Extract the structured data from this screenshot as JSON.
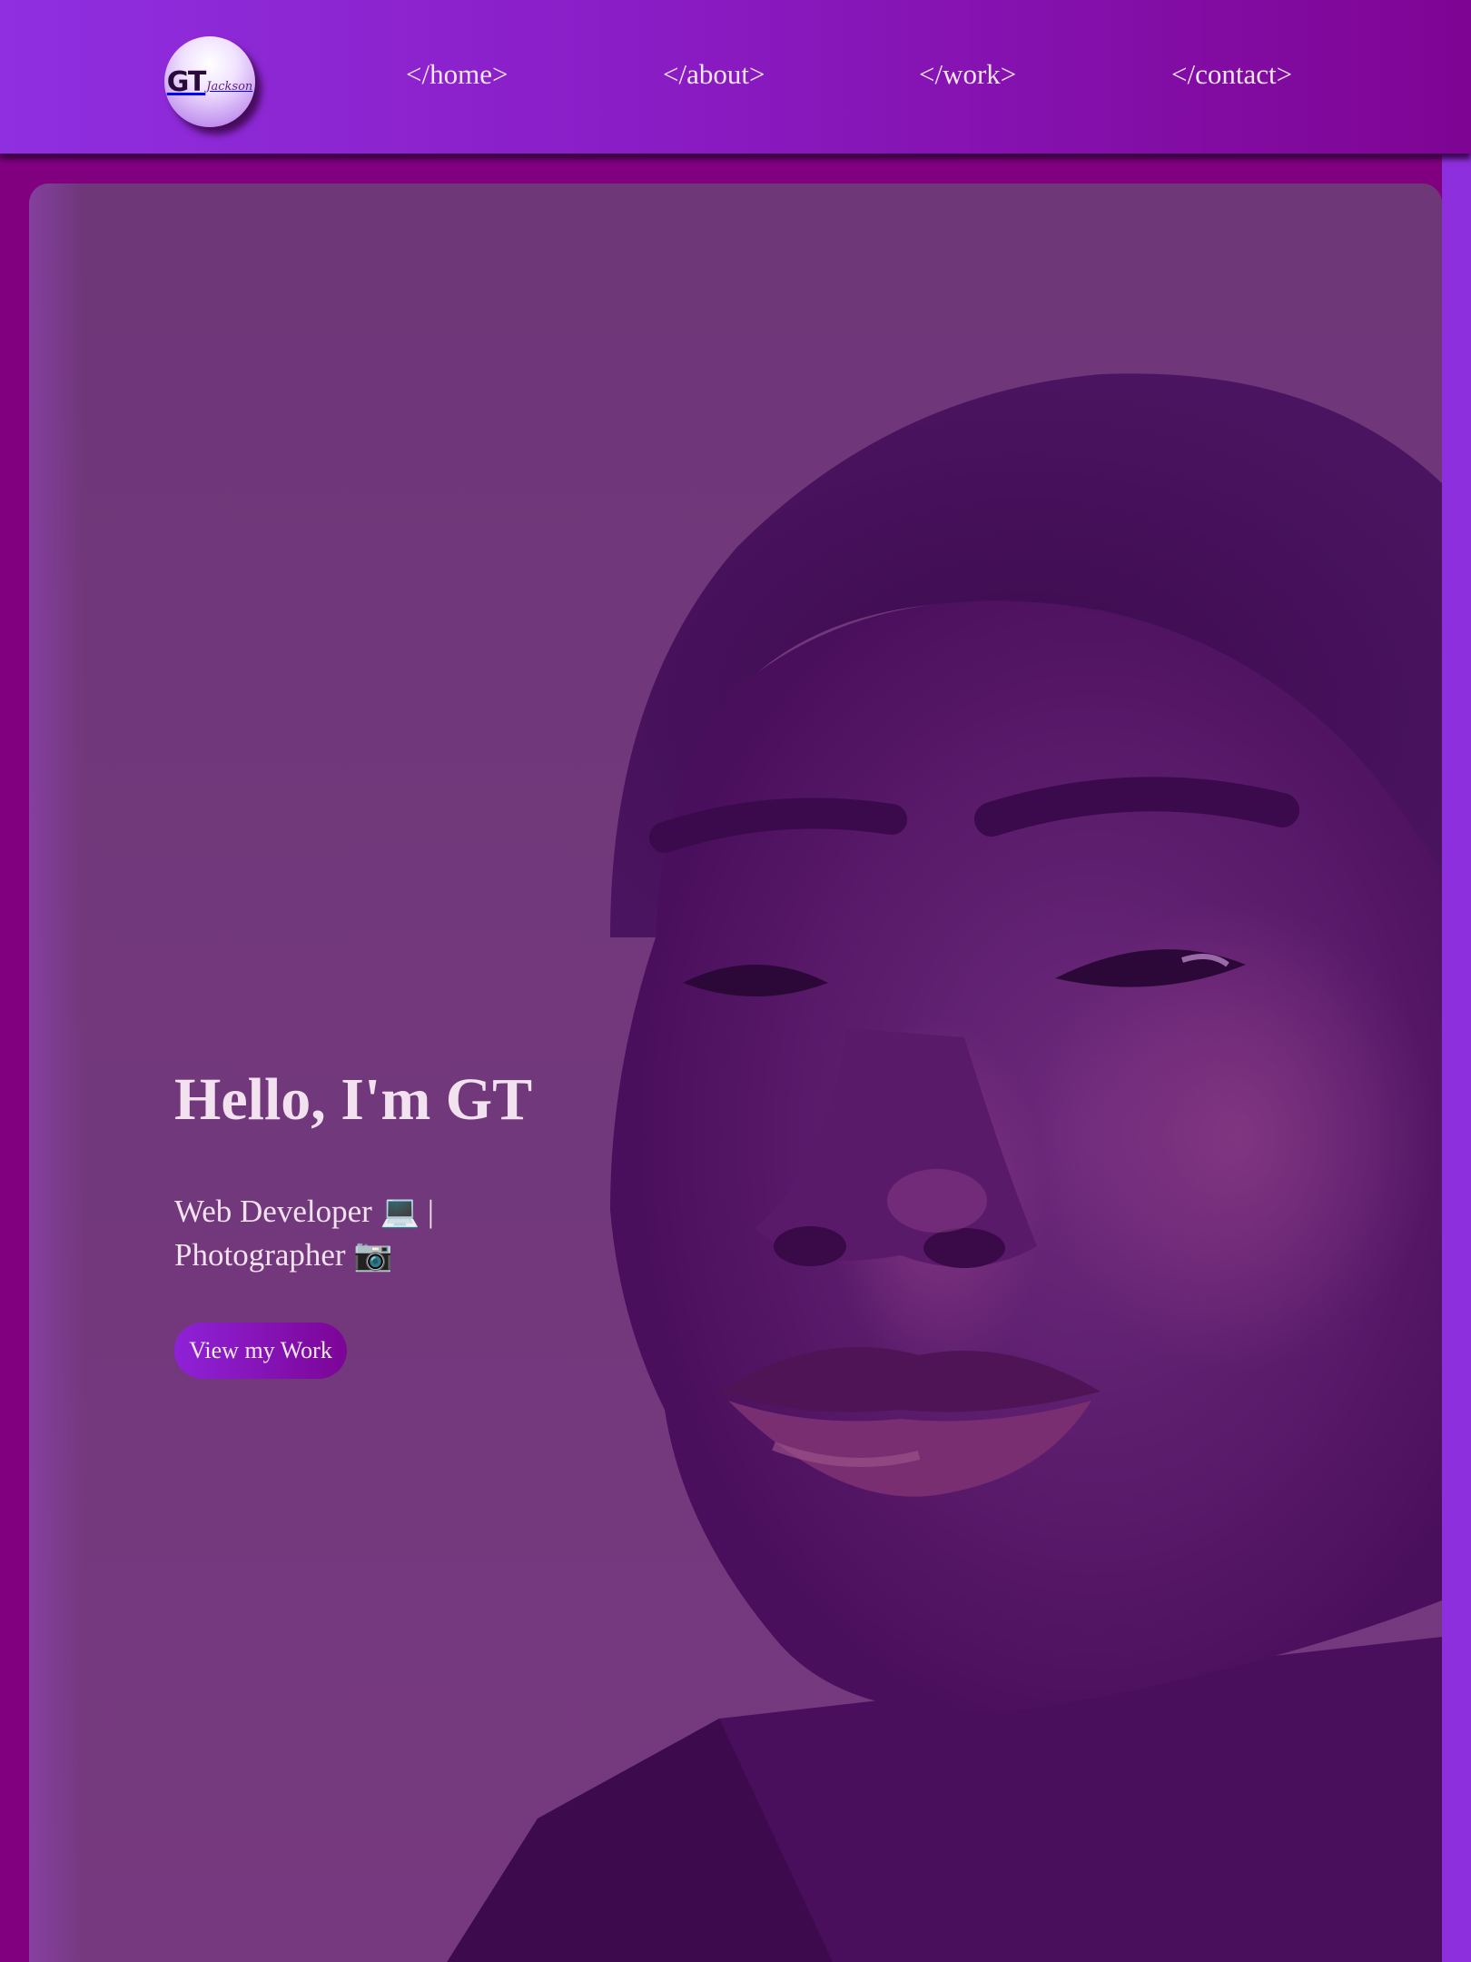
{
  "nav": {
    "logo": {
      "initials": "GT",
      "script": "Jackson"
    },
    "links": [
      "</home>",
      "</about>",
      "</work>",
      "</contact>"
    ]
  },
  "hero": {
    "title": "Hello, I'm GT",
    "subtitle": "Web Developer 💻 | Photographer 📷",
    "button_label": "View my Work",
    "image": "portrait-photo"
  },
  "colors": {
    "page_background": "#800080",
    "nav_gradient_start": "#8f2fe0",
    "nav_gradient_end": "#7e0493",
    "hero_overlay": "#733a7c",
    "text": "#f2e2ef"
  }
}
